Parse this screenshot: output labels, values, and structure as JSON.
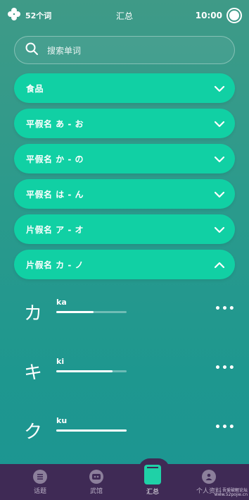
{
  "status": {
    "word_count": "52个词",
    "title": "汇总",
    "time": "10:00"
  },
  "search": {
    "placeholder": "搜索单词"
  },
  "categories": [
    {
      "label": "食品",
      "expanded": false
    },
    {
      "label": "平假名 あ - お",
      "expanded": false
    },
    {
      "label": "平假名 か - の",
      "expanded": false
    },
    {
      "label": "平假名 は - ん",
      "expanded": false
    },
    {
      "label": "片假名 ア - オ",
      "expanded": false
    },
    {
      "label": "片假名 カ - ノ",
      "expanded": true
    }
  ],
  "words": [
    {
      "kana": "カ",
      "romaji": "ka",
      "progress": 0.53
    },
    {
      "kana": "キ",
      "romaji": "ki",
      "progress": 0.8
    },
    {
      "kana": "ク",
      "romaji": "ku",
      "progress": 1.0
    }
  ],
  "more_label": "•••",
  "nav": [
    {
      "label": "话题",
      "icon": "topics-icon",
      "active": false
    },
    {
      "label": "武馆",
      "icon": "dojo-icon",
      "active": false
    },
    {
      "label": "汇总",
      "icon": "summary-icon",
      "active": true
    },
    {
      "label": "个人资料",
      "icon": "profile-icon",
      "active": false
    }
  ],
  "watermark": {
    "line1": "吾爱破解论坛",
    "line2": "www.52pojie.cn"
  },
  "colors": {
    "accent": "#11d0a4",
    "nav_bg": "#3f2a55"
  }
}
